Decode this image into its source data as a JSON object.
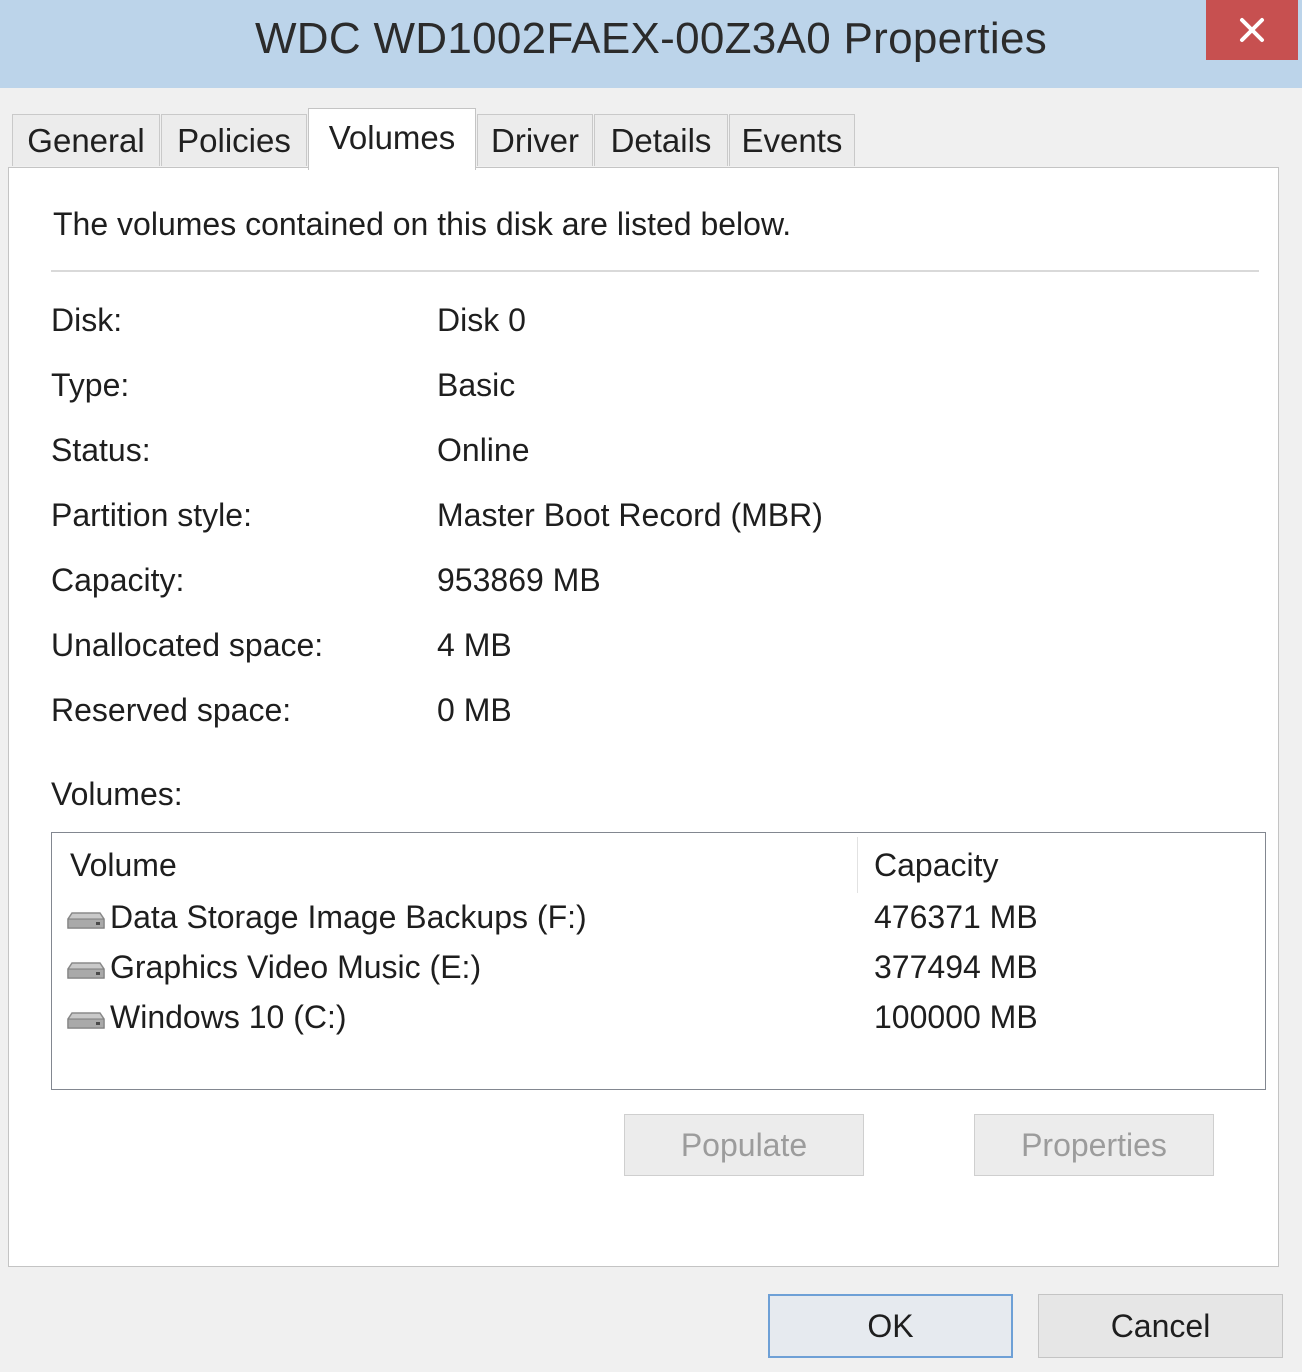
{
  "window": {
    "title": "WDC WD1002FAEX-00Z3A0 Properties",
    "close_glyph": "✕",
    "titlebar_color": "#bcd4ea",
    "close_color": "#c75050"
  },
  "tabs": [
    {
      "label": "General",
      "active": false
    },
    {
      "label": "Policies",
      "active": false
    },
    {
      "label": "Volumes",
      "active": true
    },
    {
      "label": "Driver",
      "active": false
    },
    {
      "label": "Details",
      "active": false
    },
    {
      "label": "Events",
      "active": false
    }
  ],
  "volumes_tab": {
    "description": "The volumes contained on this disk are listed below.",
    "properties": [
      {
        "label": "Disk:",
        "value": "Disk 0"
      },
      {
        "label": "Type:",
        "value": "Basic"
      },
      {
        "label": "Status:",
        "value": "Online"
      },
      {
        "label": "Partition style:",
        "value": "Master Boot Record (MBR)"
      },
      {
        "label": "Capacity:",
        "value": "953869 MB"
      },
      {
        "label": "Unallocated space:",
        "value": "4 MB"
      },
      {
        "label": "Reserved space:",
        "value": "0 MB"
      }
    ],
    "volumes_label": "Volumes:",
    "columns": {
      "volume": "Volume",
      "capacity": "Capacity"
    },
    "rows": [
      {
        "volume": "Data Storage Image Backups (F:)",
        "capacity": "476371 MB",
        "icon": "drive-icon"
      },
      {
        "volume": "Graphics Video Music (E:)",
        "capacity": "377494 MB",
        "icon": "drive-icon"
      },
      {
        "volume": "Windows 10 (C:)",
        "capacity": "100000 MB",
        "icon": "drive-icon"
      }
    ],
    "buttons": {
      "populate": "Populate",
      "properties": "Properties"
    }
  },
  "footer": {
    "ok": "OK",
    "cancel": "Cancel"
  }
}
